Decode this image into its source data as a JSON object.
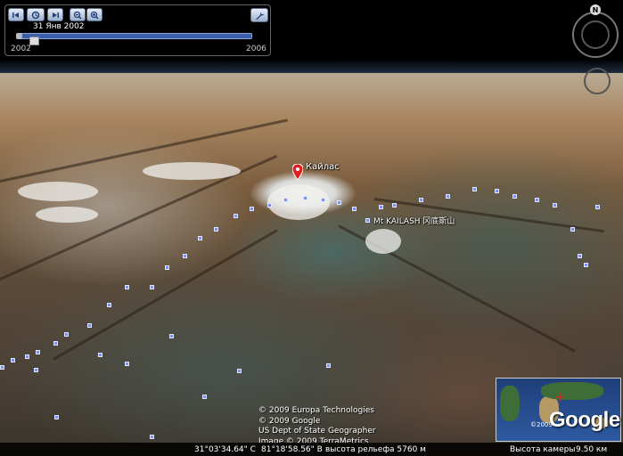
{
  "time_slider": {
    "current_date": "31 Янв 2002",
    "start_year": "2002",
    "end_year": "2006"
  },
  "placemarks": [
    {
      "label": "Кайлас",
      "icon": "placemark-pin-icon"
    },
    {
      "label": "Mt KAILASH 冈底斯山"
    }
  ],
  "navigation": {
    "north_label": "N"
  },
  "copyright": [
    "© 2009 Europa Technologies",
    "© 2009 Google",
    "US Dept of State Geographer",
    "Image © 2009 TerraMetrics"
  ],
  "overview_map": {
    "copyright": "©2009",
    "logo": "Google"
  },
  "status_bar": {
    "latitude": "31°03'34.64\" С",
    "longitude": "81°18'58.56\" В",
    "elevation": "высота рельефа 5760 м",
    "camera_label": "Высота камеры",
    "camera_height": "9.50 км"
  },
  "colors": {
    "trail": "#7a8fff",
    "pin": "#e02020",
    "slider_track": "#3a5fa8"
  }
}
